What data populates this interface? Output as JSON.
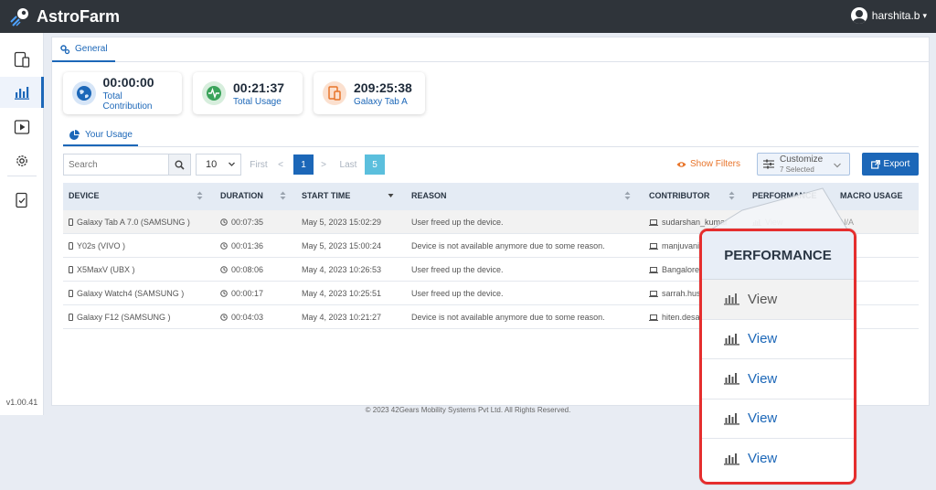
{
  "app": {
    "name": "AstroFarm",
    "version": "v1.00.41"
  },
  "user": {
    "name": "harshita.b"
  },
  "sidebar": {
    "items": [
      "devices-icon",
      "bar-chart-icon",
      "play-icon",
      "gear-icon",
      "checklist-icon"
    ],
    "active": "bar-chart-icon"
  },
  "tabs": {
    "general": "General"
  },
  "stats": [
    {
      "value": "00:00:00",
      "label": "Total Contribution",
      "icon": "globe-icon",
      "color": "#1c67b8"
    },
    {
      "value": "00:21:37",
      "label": "Total Usage",
      "icon": "pulse-icon",
      "color": "#3aa35a"
    },
    {
      "value": "209:25:38",
      "label": "Galaxy Tab A",
      "icon": "device-icon",
      "color": "#e8742a"
    }
  ],
  "usage_tab": "Your Usage",
  "toolbar": {
    "search_placeholder": "Search",
    "page_size": "10",
    "first": "First",
    "prev": "<",
    "current_page": "1",
    "next": ">",
    "last": "Last",
    "last_page": "5",
    "show_filters": "Show Filters",
    "customize": "Customize",
    "customize_sub": "7 Selected",
    "export": "Export"
  },
  "table": {
    "headers": [
      "DEVICE",
      "DURATION",
      "START TIME",
      "REASON",
      "CONTRIBUTOR",
      "PERFORMANCE",
      "MACRO USAGE"
    ],
    "rows": [
      {
        "device": "Galaxy Tab A 7.0 (SAMSUNG )",
        "duration": "00:07:35",
        "start": "May 5, 2023 15:02:29",
        "reason": "User freed up the device.",
        "contributor": "sudarshan_kumar",
        "performance": "View",
        "macro": "N/A"
      },
      {
        "device": "Y02s (VIVO )",
        "duration": "00:01:36",
        "start": "May 5, 2023 15:00:24",
        "reason": "Device is not available anymore due to some reason.",
        "contributor": "manjuvani.l",
        "performance": "",
        "macro": ""
      },
      {
        "device": "X5MaxV (UBX )",
        "duration": "00:08:06",
        "start": "May 4, 2023 10:26:53",
        "reason": "User freed up the device.",
        "contributor": "Bangalore C",
        "performance": "",
        "macro": ""
      },
      {
        "device": "Galaxy Watch4 (SAMSUNG )",
        "duration": "00:00:17",
        "start": "May 4, 2023 10:25:51",
        "reason": "User freed up the device.",
        "contributor": "sarrah.husa",
        "performance": "",
        "macro": ""
      },
      {
        "device": "Galaxy F12 (SAMSUNG )",
        "duration": "00:04:03",
        "start": "May 4, 2023 10:21:27",
        "reason": "Device is not available anymore due to some reason.",
        "contributor": "hiten.desai",
        "performance": "",
        "macro": ""
      }
    ]
  },
  "popup": {
    "title": "PERFORMANCE",
    "items": [
      "View",
      "View",
      "View",
      "View",
      "View"
    ],
    "border_color": "#e52e2e"
  },
  "footer": "© 2023 42Gears Mobility Systems Pvt Ltd. All Rights Reserved."
}
